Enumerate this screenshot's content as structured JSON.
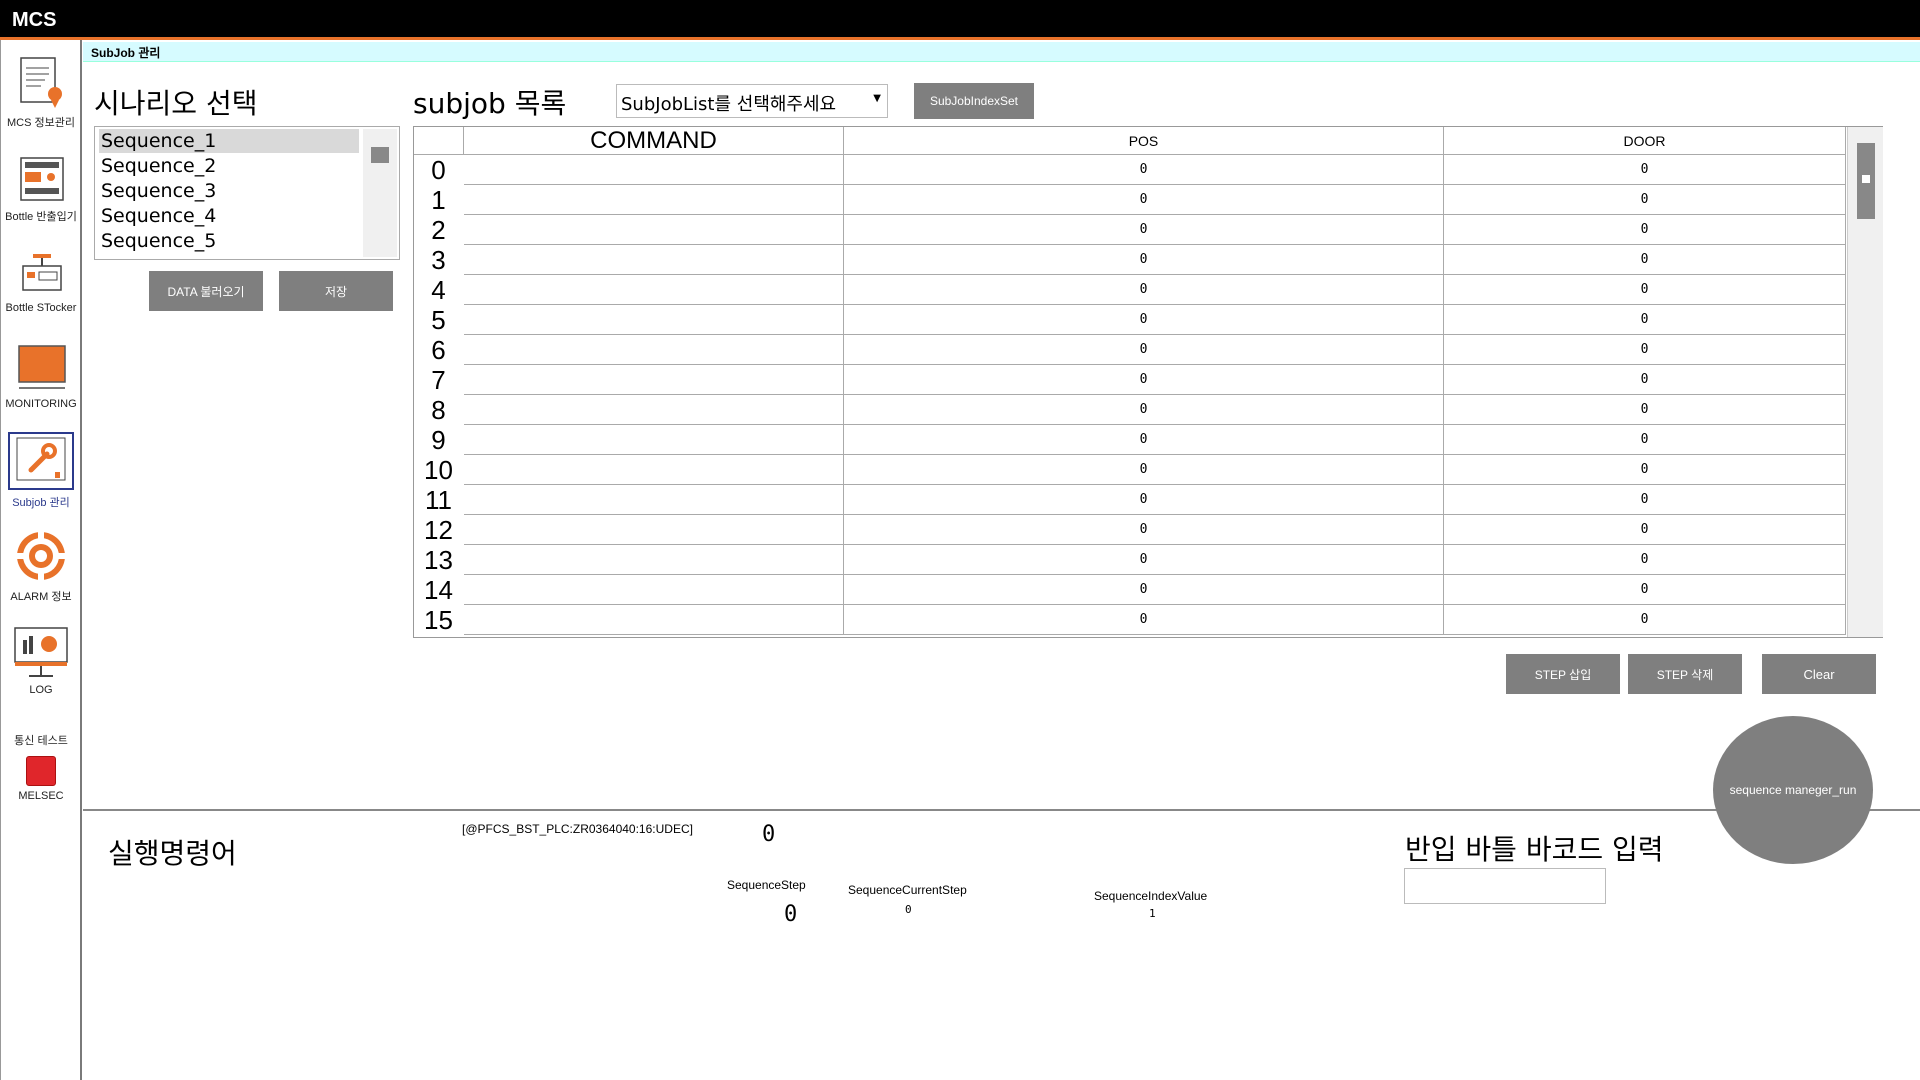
{
  "app": {
    "title": "MCS",
    "accent": "#e8722a"
  },
  "tab": {
    "label": "SubJob 관리"
  },
  "sidebar": {
    "items": [
      {
        "label": "MCS 정보관리",
        "icon": "document-settings-icon"
      },
      {
        "label": "Bottle 반출입기",
        "icon": "machine-panel-icon"
      },
      {
        "label": "Bottle STocker",
        "icon": "stocker-icon"
      },
      {
        "label": "MONITORING",
        "icon": "monitor-icon"
      },
      {
        "label": "Subjob 관리",
        "icon": "wrench-icon",
        "active": true
      },
      {
        "label": "ALARM 정보",
        "icon": "alarm-ring-icon"
      },
      {
        "label": "LOG",
        "icon": "chart-monitor-icon"
      }
    ],
    "comm_test": {
      "label": "통신 테스트",
      "status_label": "MELSEC",
      "status_color": "#e0262b"
    }
  },
  "scenario": {
    "title": "시나리오 선택",
    "items": [
      "Sequence_1",
      "Sequence_2",
      "Sequence_3",
      "Sequence_4",
      "Sequence_5"
    ],
    "selected_index": 0,
    "load_button": "DATA 불러오기",
    "save_button": "저장"
  },
  "subjob": {
    "title": "subjob 목록",
    "select_value": "SubJobList를 선택해주세요",
    "index_set_button": "SubJobIndexSet",
    "columns": [
      "COMMAND",
      "POS",
      "DOOR"
    ],
    "rows": [
      {
        "index": "0",
        "command": "",
        "pos": "0",
        "door": "0"
      },
      {
        "index": "1",
        "command": "",
        "pos": "0",
        "door": "0"
      },
      {
        "index": "2",
        "command": "",
        "pos": "0",
        "door": "0"
      },
      {
        "index": "3",
        "command": "",
        "pos": "0",
        "door": "0"
      },
      {
        "index": "4",
        "command": "",
        "pos": "0",
        "door": "0"
      },
      {
        "index": "5",
        "command": "",
        "pos": "0",
        "door": "0"
      },
      {
        "index": "6",
        "command": "",
        "pos": "0",
        "door": "0"
      },
      {
        "index": "7",
        "command": "",
        "pos": "0",
        "door": "0"
      },
      {
        "index": "8",
        "command": "",
        "pos": "0",
        "door": "0"
      },
      {
        "index": "9",
        "command": "",
        "pos": "0",
        "door": "0"
      },
      {
        "index": "10",
        "command": "",
        "pos": "0",
        "door": "0"
      },
      {
        "index": "11",
        "command": "",
        "pos": "0",
        "door": "0"
      },
      {
        "index": "12",
        "command": "",
        "pos": "0",
        "door": "0"
      },
      {
        "index": "13",
        "command": "",
        "pos": "0",
        "door": "0"
      },
      {
        "index": "14",
        "command": "",
        "pos": "0",
        "door": "0"
      },
      {
        "index": "15",
        "command": "",
        "pos": "0",
        "door": "0"
      }
    ],
    "step_insert_button": "STEP 삽입",
    "step_delete_button": "STEP 삭제",
    "clear_button": "Clear",
    "run_button": "sequence maneger_run"
  },
  "exec": {
    "title": "실행명령어",
    "plc_address": "[@PFCS_BST_PLC:ZR0364040:16:UDEC]",
    "plc_value": "0",
    "sequence_step_label": "SequenceStep",
    "sequence_step_value": "0",
    "current_step_label": "SequenceCurrentStep",
    "current_step_value": "0",
    "index_value_label": "SequenceIndexValue",
    "index_value": "1"
  },
  "barcode": {
    "title": "반입 바틀 바코드 입력",
    "value": ""
  }
}
